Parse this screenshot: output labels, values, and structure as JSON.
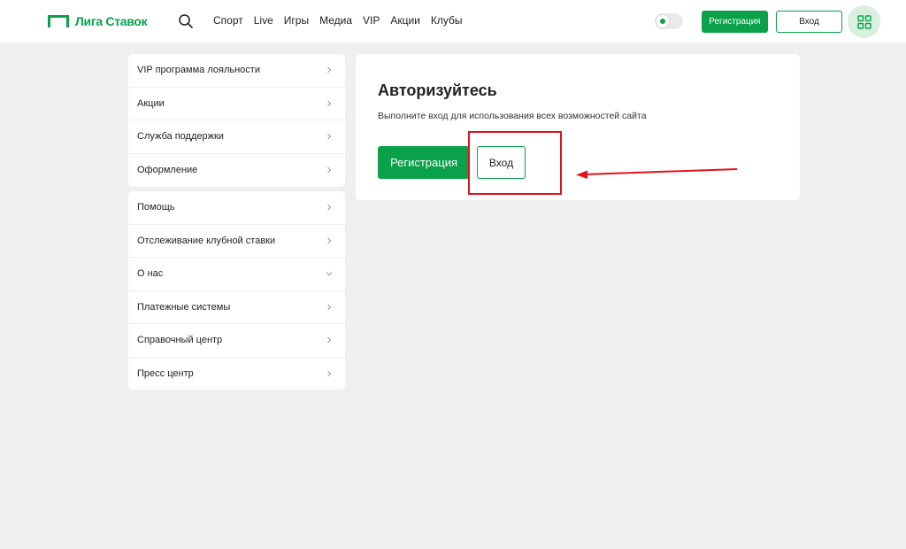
{
  "header": {
    "logo_text": "Лига Ставок",
    "nav": [
      "Спорт",
      "Live",
      "Игры",
      "Медиа",
      "VIP",
      "Акции",
      "Клубы"
    ],
    "register_label": "Регистрация",
    "login_label": "Вход"
  },
  "sidebar": {
    "group1": [
      {
        "label": "VIP программа лояльности",
        "chevron": "right"
      },
      {
        "label": "Акции",
        "chevron": "right"
      },
      {
        "label": "Служба поддержки",
        "chevron": "right"
      },
      {
        "label": "Оформление",
        "chevron": "right"
      }
    ],
    "group2": [
      {
        "label": "Помощь",
        "chevron": "right"
      },
      {
        "label": "Отслеживание клубной ставки",
        "chevron": "right"
      },
      {
        "label": "О нас",
        "chevron": "down"
      },
      {
        "label": "Платежные системы",
        "chevron": "right"
      },
      {
        "label": "Справочный центр",
        "chevron": "right"
      },
      {
        "label": "Пресс центр",
        "chevron": "right"
      }
    ]
  },
  "main": {
    "title": "Авторизуйтесь",
    "subtitle": "Выполните вход для использования всех возможностей сайта",
    "register_label": "Регистрация",
    "login_label": "Вход"
  },
  "colors": {
    "brand_green": "#0aa14a",
    "annotation_red": "#e0121b",
    "background": "#efefef"
  },
  "icons": [
    "search-icon",
    "grid-menu-icon",
    "chevron-right-icon",
    "chevron-down-icon"
  ]
}
